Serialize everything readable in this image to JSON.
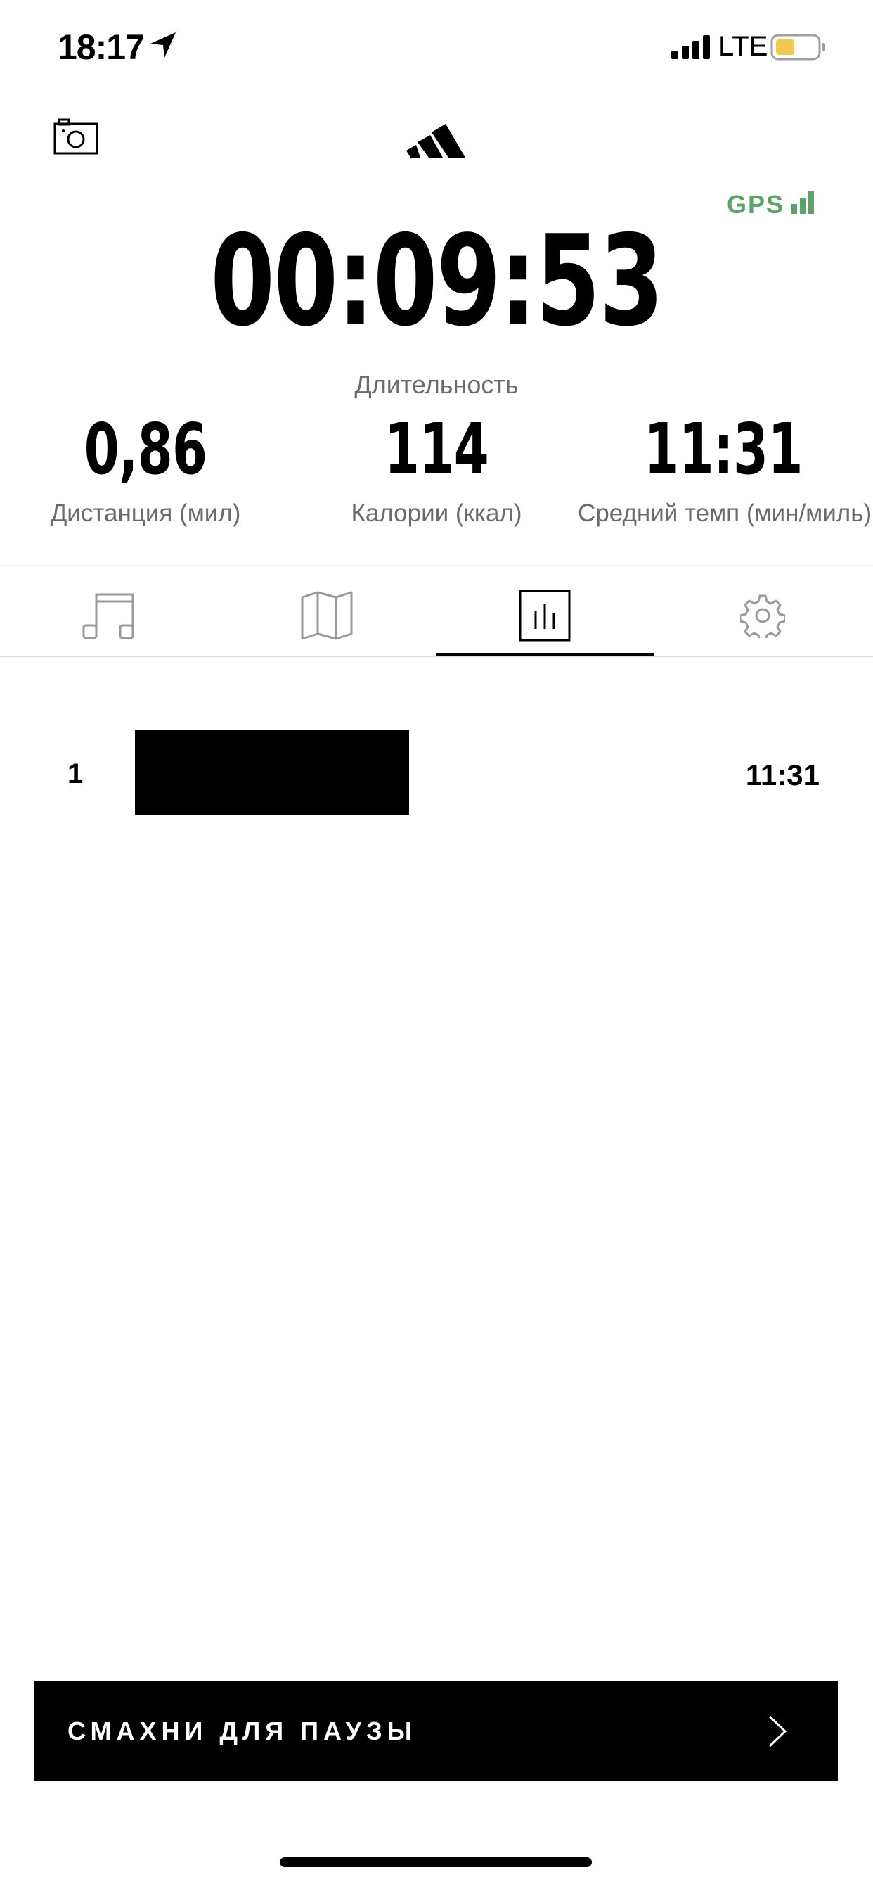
{
  "status_bar": {
    "time": "18:17",
    "network": "LTE",
    "battery_color": "#f2c94c"
  },
  "gps": {
    "label": "GPS",
    "color": "#5aa469"
  },
  "timer": {
    "value": "00:09:53",
    "label": "Длительность"
  },
  "metrics": [
    {
      "value": "0,86",
      "label": "Дистанция (мил)"
    },
    {
      "value": "114",
      "label": "Калории (ккал)"
    },
    {
      "value": "11:31",
      "label": "Средний темп (мин/миль)"
    }
  ],
  "tabs": [
    {
      "icon": "music-icon",
      "active": false
    },
    {
      "icon": "map-icon",
      "active": false
    },
    {
      "icon": "bar-chart-icon",
      "active": true
    },
    {
      "icon": "gear-icon",
      "active": false
    }
  ],
  "splits": [
    {
      "number": "1",
      "pace": "11:31"
    }
  ],
  "swipe_pause": {
    "label": "СМАХНИ ДЛЯ ПАУЗЫ"
  }
}
